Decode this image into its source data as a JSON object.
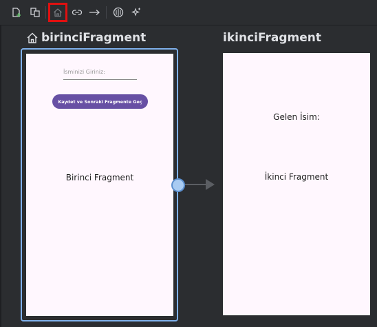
{
  "toolbar": {
    "buttons": [
      {
        "id": "new-destination",
        "icon": "new-destination-icon"
      },
      {
        "id": "nested-graph",
        "icon": "nested-graph-icon"
      },
      {
        "id": "assign-start",
        "icon": "home-icon",
        "selected": true
      },
      {
        "id": "deep-link",
        "icon": "link-icon"
      },
      {
        "id": "add-action",
        "icon": "arrow-right-icon"
      },
      {
        "id": "auto-arrange",
        "icon": "auto-arrange-icon"
      },
      {
        "id": "magic",
        "icon": "sparkle-icon"
      }
    ]
  },
  "destinations": [
    {
      "title": "birinciFragment",
      "is_start": true,
      "input_hint": "İsminizi Giriniz:",
      "button_label": "Kaydet ve Sonraki Fragmente Geç",
      "body_text": "Birinci Fragment"
    },
    {
      "title": "ikinciFragment",
      "is_start": false,
      "label_text": "Gelen İsim:",
      "body_text": "İkinci Fragment"
    }
  ],
  "colors": {
    "selection_border": "#7fb1ec",
    "highlight": "#e01010",
    "button_bg": "#6750a4",
    "phone_bg": "#fff7fe"
  }
}
